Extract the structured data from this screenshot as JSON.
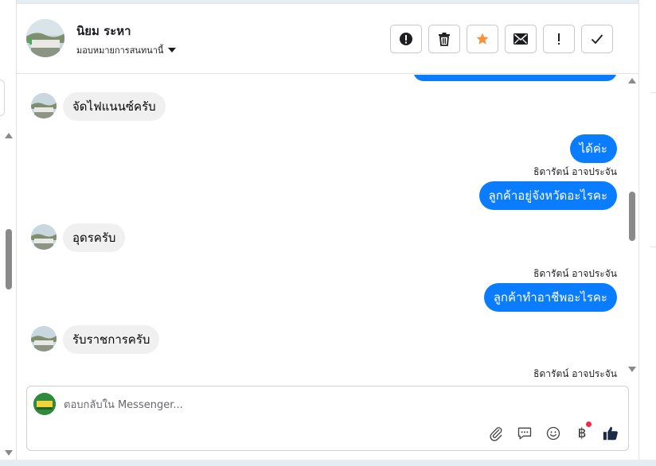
{
  "header": {
    "contact_name": "นิยม ระหา",
    "assign_label": "มอบหมายการสนทนานี้",
    "actions": [
      {
        "name": "spam",
        "icon": "exclamation-circle-icon"
      },
      {
        "name": "delete",
        "icon": "trash-icon"
      },
      {
        "name": "star",
        "icon": "star-icon",
        "color": "#f7923b"
      },
      {
        "name": "mark-unread",
        "icon": "envelope-icon"
      },
      {
        "name": "follow-up",
        "icon": "exclamation-icon"
      },
      {
        "name": "done",
        "icon": "checkmark-icon"
      }
    ]
  },
  "messages": [
    {
      "type": "incoming",
      "text": "จัดไฟแนนซ์ครับ"
    },
    {
      "type": "outgoing",
      "text": "ได้ค่ะ"
    },
    {
      "type": "sender",
      "text": "ธิดารัตน์ อาจประจัน"
    },
    {
      "type": "outgoing",
      "text": "ลูกค้าอยู่จังหวัดอะไรคะ"
    },
    {
      "type": "incoming",
      "text": "อุดรครับ"
    },
    {
      "type": "sender",
      "text": "ธิดารัตน์ อาจประจัน"
    },
    {
      "type": "outgoing",
      "text": "ลูกค้าทำอาชีพอะไรคะ"
    },
    {
      "type": "incoming",
      "text": "รับราชการครับ"
    },
    {
      "type": "sender",
      "text": "ธิดารัตน์ อาจประจัน"
    }
  ],
  "composer": {
    "placeholder": "ตอบกลับใน Messenger...",
    "tools": [
      "paperclip-icon",
      "speech-bubble-icon",
      "emoji-icon",
      "baht-icon",
      "thumbs-up-icon"
    ],
    "baht_symbol": "฿",
    "notification_dot_color": "#f02849"
  },
  "colors": {
    "outgoing_bubble": "#0a7cff",
    "incoming_bubble": "#f0f0f0",
    "like_icon": "#1c2b4a"
  }
}
